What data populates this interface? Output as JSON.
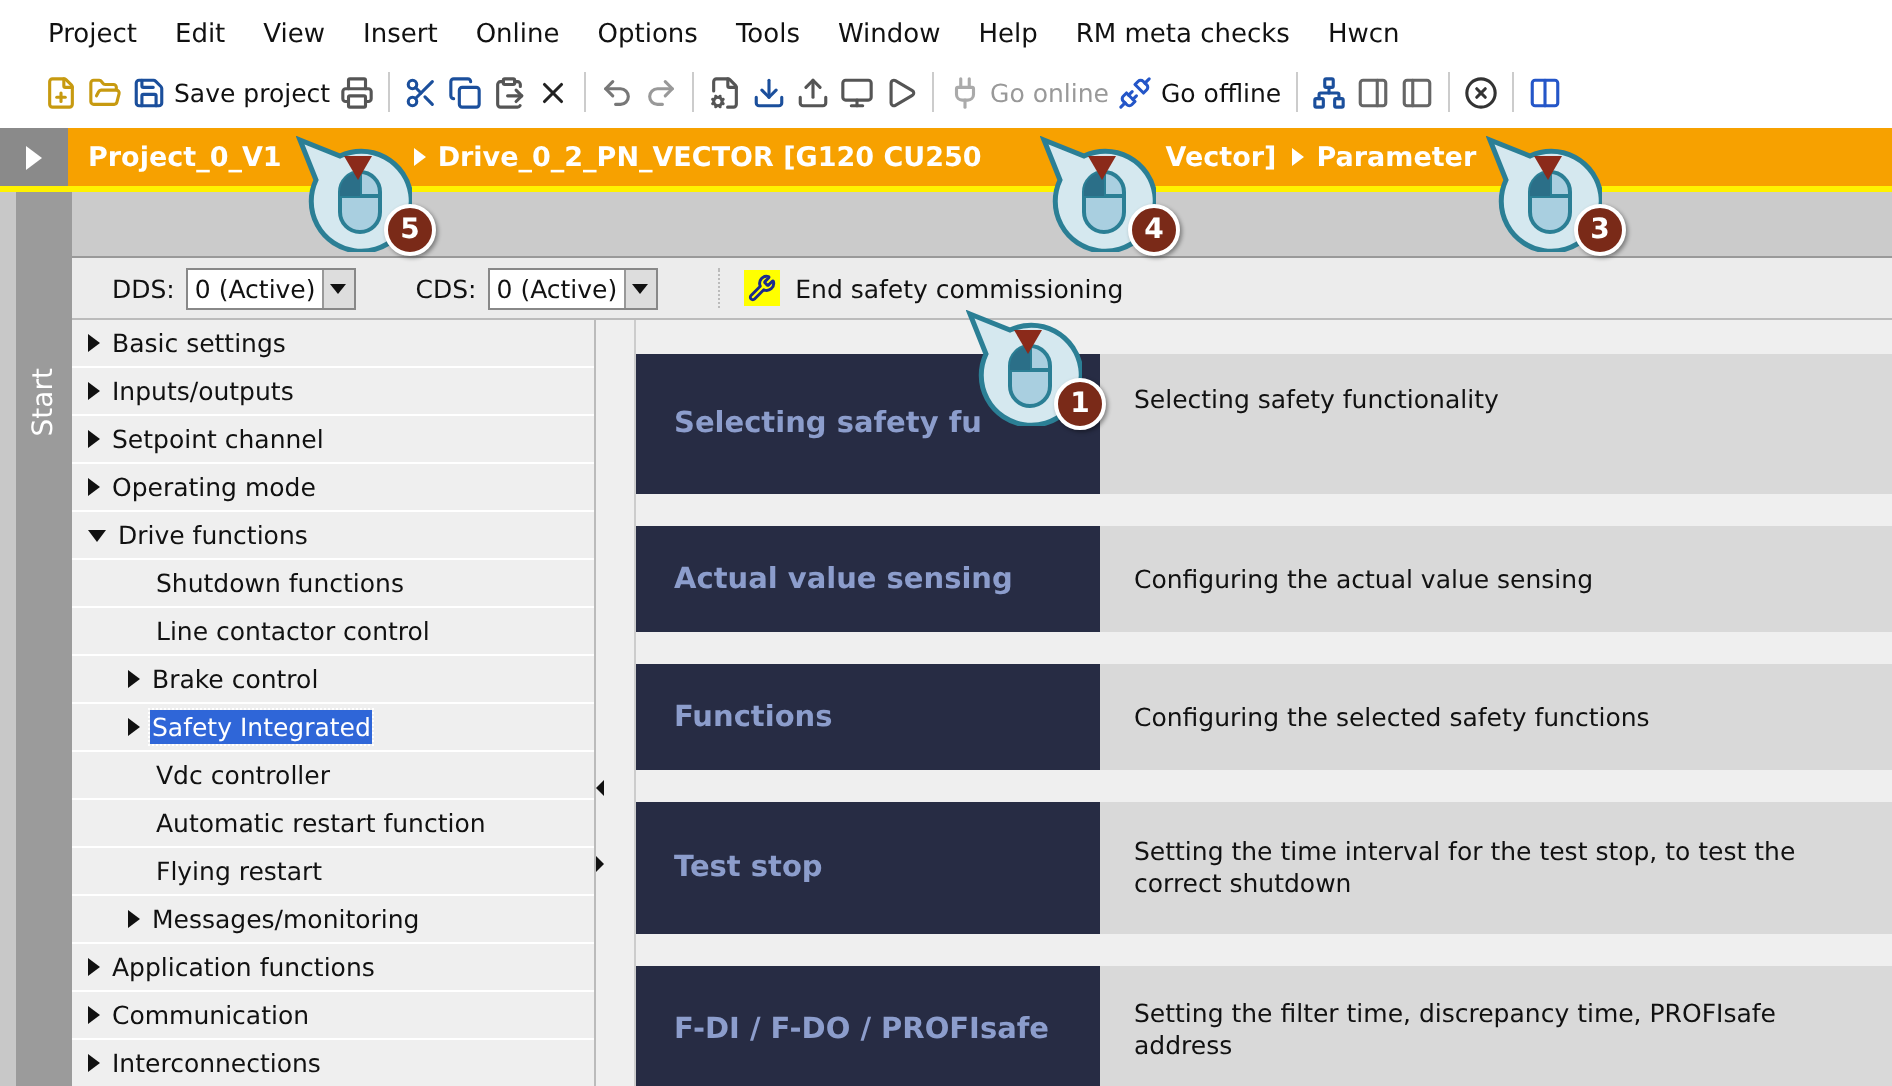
{
  "menu": [
    "Project",
    "Edit",
    "View",
    "Insert",
    "Online",
    "Options",
    "Tools",
    "Window",
    "Help",
    "RM meta checks",
    "Hwcn"
  ],
  "toolbar": [
    {
      "kind": "text",
      "label": "Save project",
      "disabled": false
    },
    {
      "kind": "text",
      "label": "Go online",
      "disabled": true
    },
    {
      "kind": "text",
      "label": "Go offline",
      "disabled": false
    }
  ],
  "breadcrumb": [
    "Project_0_V1",
    "Drive_0_2_PN_VECTOR [G120 CU250",
    "Vector]",
    "Parameter"
  ],
  "side_tab": "Start",
  "param_bar": {
    "dds_label": "DDS:",
    "dds_value": "0 (Active)",
    "cds_label": "CDS:",
    "cds_value": "0 (Active)",
    "action": "End safety commissioning"
  },
  "tree": [
    {
      "label": "Basic settings",
      "kind": "group",
      "expanded": false,
      "selected": false
    },
    {
      "label": "Inputs/outputs",
      "kind": "group",
      "expanded": false,
      "selected": false
    },
    {
      "label": "Setpoint channel",
      "kind": "group",
      "expanded": false,
      "selected": false
    },
    {
      "label": "Operating mode",
      "kind": "group",
      "expanded": false,
      "selected": false
    },
    {
      "label": "Drive functions",
      "kind": "group",
      "expanded": true,
      "selected": false,
      "children": [
        {
          "label": "Shutdown functions",
          "kind": "leaf",
          "selected": false
        },
        {
          "label": "Line contactor control",
          "kind": "leaf",
          "selected": false
        },
        {
          "label": "Brake control",
          "kind": "group",
          "expanded": false,
          "selected": false
        },
        {
          "label": "Safety Integrated",
          "kind": "group",
          "expanded": false,
          "selected": true
        },
        {
          "label": "Vdc controller",
          "kind": "leaf",
          "selected": false
        },
        {
          "label": "Automatic restart function",
          "kind": "leaf",
          "selected": false
        },
        {
          "label": "Flying restart",
          "kind": "leaf",
          "selected": false
        },
        {
          "label": "Messages/monitoring",
          "kind": "group",
          "expanded": false,
          "selected": false
        }
      ]
    },
    {
      "label": "Application functions",
      "kind": "group",
      "expanded": false,
      "selected": false
    },
    {
      "label": "Communication",
      "kind": "group",
      "expanded": false,
      "selected": false
    },
    {
      "label": "Interconnections",
      "kind": "group",
      "expanded": false,
      "selected": false
    }
  ],
  "steps": [
    {
      "title": "Selecting safety fu",
      "description": "Selecting safety functionality"
    },
    {
      "title": "Actual value sensing",
      "description": "Configuring the actual value sensing"
    },
    {
      "title": "Functions",
      "description": "Configuring the selected safety functions"
    },
    {
      "title": "Test stop",
      "description": "Setting the time interval for the test stop, to test the correct shutdown"
    },
    {
      "title": "F-DI / F-DO / PROFIsafe",
      "description": "Setting the filter time, discrepancy time, PROFIsafe address"
    }
  ],
  "callouts": [
    {
      "number": "5"
    },
    {
      "number": "4"
    },
    {
      "number": "3"
    },
    {
      "number": "1"
    }
  ]
}
